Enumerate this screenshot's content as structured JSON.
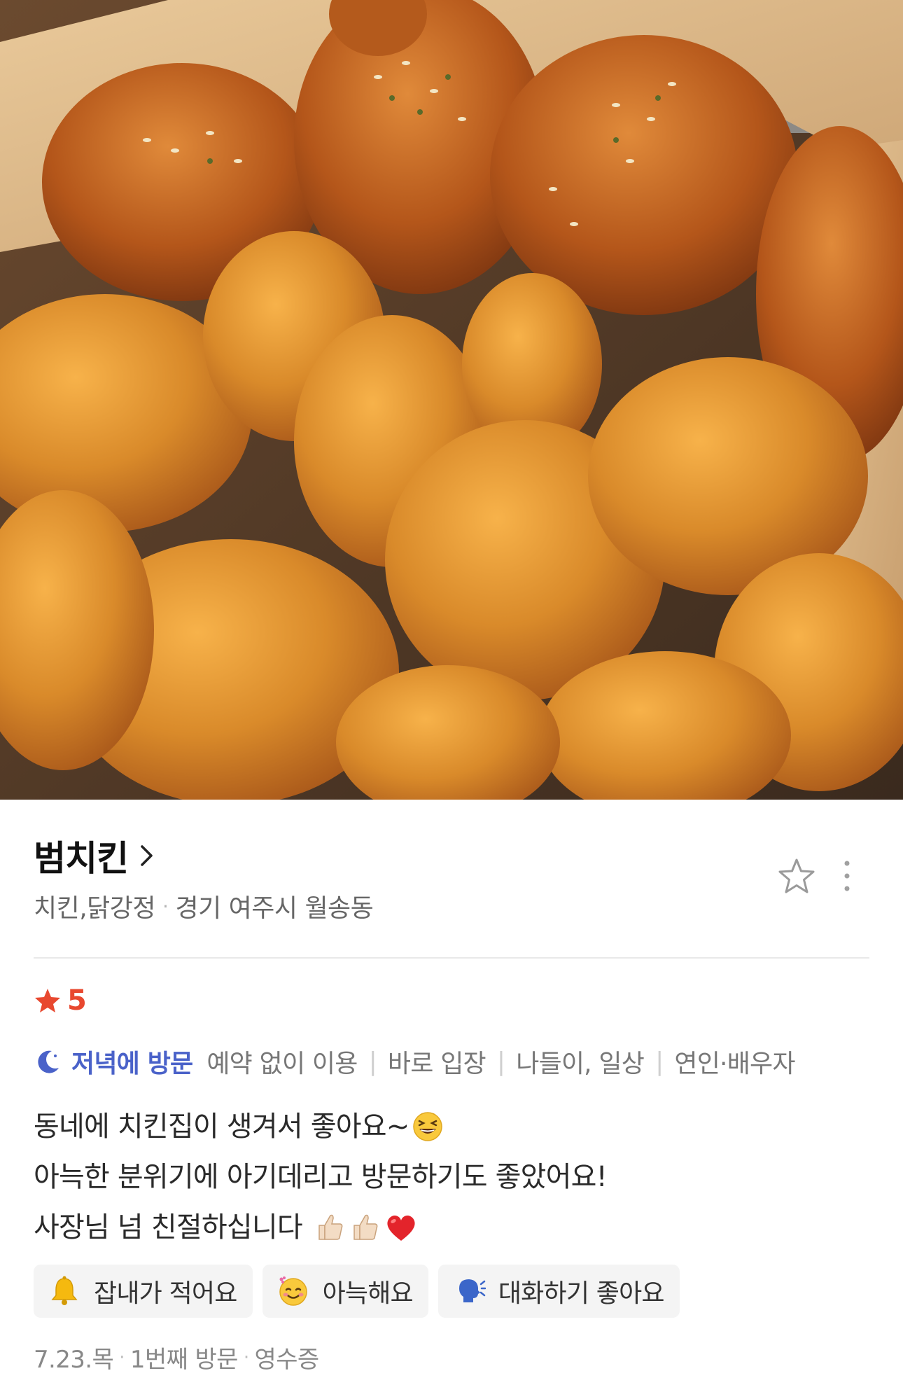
{
  "hero": {
    "photo_alt": "fried chicken photo",
    "accent": "#c77a23"
  },
  "place": {
    "name": "범치킨",
    "category": "치킨,닭강정",
    "location": "경기 여주시 월송동",
    "icons": [
      "chevron-right-icon",
      "star-outline-icon",
      "more-vertical-icon"
    ]
  },
  "review": {
    "rating": "5",
    "rating_color": "#e8482f",
    "visit_time": "저녁에 방문",
    "visit_time_color": "#4a62c9",
    "visit_tags": [
      "예약 없이 이용",
      "바로 입장",
      "나들이, 일상",
      "연인·배우자"
    ],
    "lines": [
      "동네에 치킨집이 생겨서 좋아요~",
      "아늑한 분위기에 아기데리고 방문하기도 좋았어요!",
      "사장님 넘 친절하십니다"
    ],
    "keywords": [
      {
        "icon": "bell-icon",
        "label": "잡내가 적어요"
      },
      {
        "icon": "smiling-face-icon",
        "label": "아늑해요"
      },
      {
        "icon": "speaking-head-icon",
        "label": "대화하기 좋아요"
      }
    ],
    "footer": {
      "date": "7.23.목",
      "visit_count": "1번째 방문",
      "verification": "영수증"
    }
  }
}
